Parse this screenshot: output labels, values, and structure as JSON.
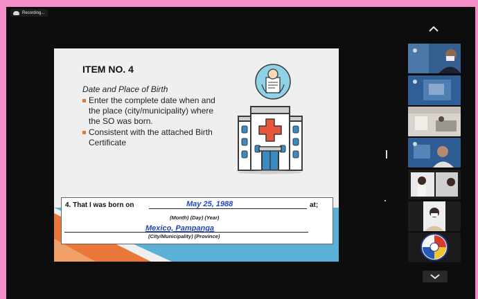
{
  "recording": {
    "label": "Recording..."
  },
  "slide": {
    "title": "ITEM NO. 4",
    "subtitle": "Date and Place of Birth",
    "bullets": [
      "Enter the complete date when and the place (city/municipality) where the SO was born.",
      "Consistent with the attached Birth Certificate"
    ],
    "form": {
      "line1": "4.   That I was born on",
      "date_value": "May 25, 1988",
      "at": "at;",
      "date_caption": "(Month) (Day) (Year)",
      "place_value": "Mexico, Pampanga",
      "place_caption": "(City/Municipality) (Province)"
    }
  },
  "participants": [
    {
      "name": "participant-1"
    },
    {
      "name": "participant-2"
    },
    {
      "name": "participant-3"
    },
    {
      "name": "participant-4"
    },
    {
      "name": "participant-5"
    },
    {
      "name": "participant-6"
    },
    {
      "name": "participant-7"
    }
  ],
  "icons": {
    "scroll_up": "chevron-up-icon",
    "scroll_down": "chevron-down-icon",
    "cloud": "cloud-icon"
  }
}
